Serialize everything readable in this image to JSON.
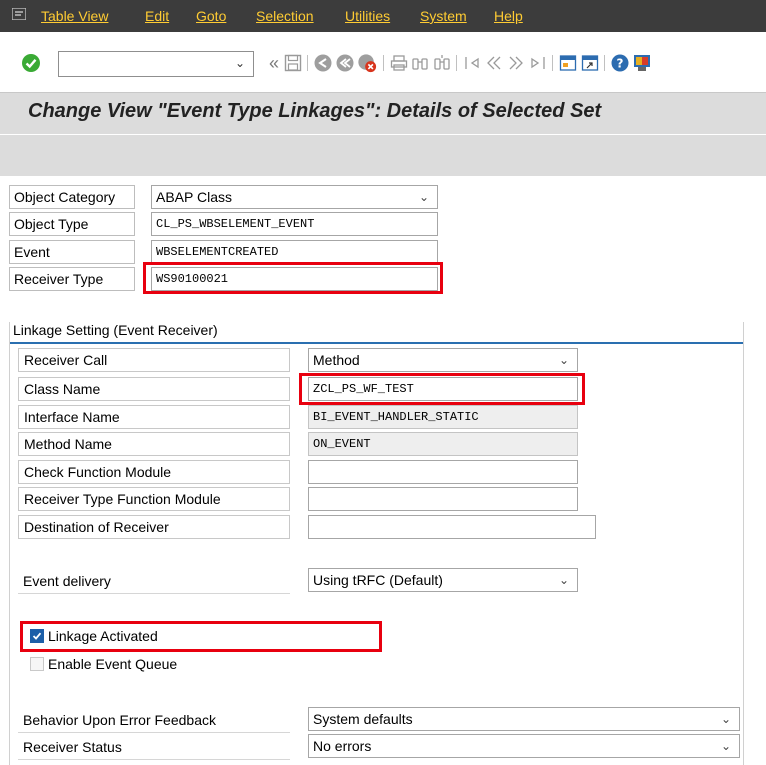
{
  "menu": {
    "items": [
      "Table View",
      "Edit",
      "Goto",
      "Selection",
      "Utilities",
      "System",
      "Help"
    ]
  },
  "toolbar": {
    "command_value": "",
    "icons": [
      "enter-icon",
      "back-double-icon",
      "save-icon",
      "back-icon",
      "exit-icon",
      "cancel-icon",
      "print-icon",
      "find-icon",
      "find-next-icon",
      "first-page-icon",
      "previous-page-icon",
      "next-page-icon",
      "last-page-icon",
      "create-session-icon",
      "shortcut-icon",
      "help-icon",
      "customize-layout-icon"
    ]
  },
  "title": "Change View \"Event Type Linkages\": Details of Selected Set",
  "header_fields": {
    "object_category": {
      "label": "Object Category",
      "value": "ABAP Class"
    },
    "object_type": {
      "label": "Object Type",
      "value": "CL_PS_WBSELEMENT_EVENT"
    },
    "event": {
      "label": "Event",
      "value": "WBSELEMENTCREATED"
    },
    "receiver_type": {
      "label": "Receiver Type",
      "value": "WS90100021"
    }
  },
  "linkage": {
    "group_title": "Linkage Setting (Event Receiver)",
    "receiver_call": {
      "label": "Receiver Call",
      "value": "Method"
    },
    "class_name": {
      "label": "Class Name",
      "value": "ZCL_PS_WF_TEST"
    },
    "interface_name": {
      "label": "Interface Name",
      "value": "BI_EVENT_HANDLER_STATIC"
    },
    "method_name": {
      "label": "Method Name",
      "value": "ON_EVENT"
    },
    "check_function_module": {
      "label": "Check Function Module",
      "value": ""
    },
    "receiver_type_function_module": {
      "label": "Receiver Type Function Module",
      "value": ""
    },
    "destination_of_receiver": {
      "label": "Destination of Receiver",
      "value": ""
    },
    "event_delivery": {
      "label": "Event delivery",
      "value": "Using tRFC (Default)"
    },
    "linkage_activated": {
      "label": "Linkage Activated",
      "checked": true
    },
    "enable_event_queue": {
      "label": "Enable Event Queue",
      "checked": false
    },
    "behavior_upon_error": {
      "label": "Behavior Upon Error Feedback",
      "value": "System defaults"
    },
    "receiver_status": {
      "label": "Receiver Status",
      "value": "No errors"
    }
  },
  "colors": {
    "menubar_bg": "#3c3c3c",
    "menu_text": "#ffcc33",
    "highlight": "#e8000f",
    "group_line": "#2a6fb0"
  }
}
